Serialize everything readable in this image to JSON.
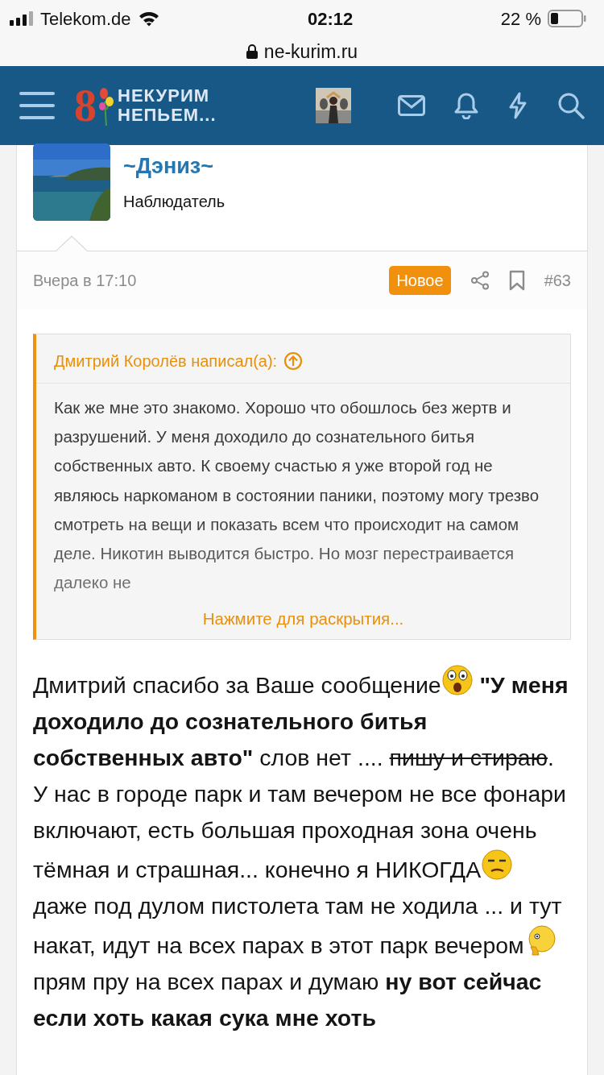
{
  "status_bar": {
    "carrier": "Telekom.de",
    "time": "02:12",
    "battery": "22 %"
  },
  "address_bar": {
    "url": "ne-kurim.ru"
  },
  "navbar": {
    "logo_digit": "8",
    "logo_lines": [
      "НЕКУРИМ",
      "НЕПЬЕМ..."
    ]
  },
  "post": {
    "author": "~Дэниз~",
    "role": "Наблюдатель",
    "time": "Вчера в 17:10",
    "badge": "Новое",
    "number": "#63",
    "quote": {
      "title": "Дмитрий Королёв написал(а):",
      "text": "Как же мне это знакомо. Хорошо что обошлось без жертв и разрушений. У меня доходило до сознательного битья собственных авто. К своему счастью я уже второй год не являюсь наркоманом в состоянии паники, поэтому могу трезво смотреть на вещи и показать всем что происходит на самом деле. Никотин выводится быстро. Но мозг перестраивается далеко не",
      "expand": "Нажмите для раскрытия..."
    },
    "body": [
      {
        "kind": "text",
        "text": "Дмитрий спасибо за Ваше сообщение"
      },
      {
        "kind": "emoji"
      },
      {
        "kind": "bold",
        "text": " \"У меня доходило до сознательного битья собственных авто\""
      },
      {
        "kind": "text",
        "text": " слов нет .... "
      },
      {
        "kind": "strike",
        "text": "пишу и стираю"
      },
      {
        "kind": "text",
        "text": ". У нас в городе парк и там вечером не все фонари включают, есть большая проходная зона очень тёмная и страшная... конечно я НИКОГДА"
      },
      {
        "kind": "emoji"
      },
      {
        "kind": "text",
        "text": " даже под дулом пистолета там не ходила ... и тут накат, идут на всех парах в этот парк вечером"
      },
      {
        "kind": "emoji"
      },
      {
        "kind": "text",
        "text": " прям пру на всех парах и думаю "
      },
      {
        "kind": "bold",
        "text": "ну вот сейчас если хоть какая сука мне хоть"
      }
    ]
  }
}
